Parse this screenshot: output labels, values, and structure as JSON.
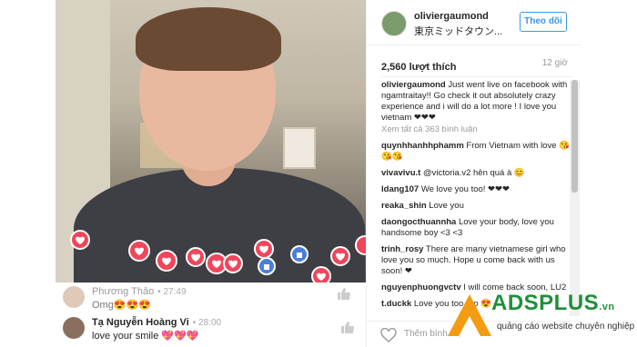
{
  "header": {
    "username": "oliviergaumond",
    "location": "東京ミッドタウン...",
    "follow_label": "Theo dõi"
  },
  "post": {
    "likes": "2,560 lượt thích",
    "time": "12 giờ"
  },
  "comments": [
    {
      "user": "oliviergaumond",
      "text": " Just went live on facebook with ngamtraitay!! Go check it out absolutely crazy experience and i will do a lot more ! I love you vietnam ❤❤❤"
    },
    {
      "user": "",
      "text": "",
      "load_more": "Xem tất cả 363 bình luận"
    },
    {
      "user": "quynhhanhhphamm",
      "text": " From Vietnam with love 😘😘😘"
    },
    {
      "user": "vivavivu.t",
      "text": " @victoria.v2 hên quá à 😊"
    },
    {
      "user": "ldang107",
      "text": " We love you too! ❤❤❤"
    },
    {
      "user": "reaka_shin",
      "text": " Love you"
    },
    {
      "user": "daongocthuannha",
      "text": " Love your body, love you handsome boy <3 <3"
    },
    {
      "user": "trinh_rosy",
      "text": " There are many vietnamese girl who love you so much. Hope u come back with us soon! ❤"
    },
    {
      "user": "nguyenphuongvctv",
      "text": " I will come back soon, LU2"
    },
    {
      "user": "t.duckk",
      "text": " Love you too bro 😍"
    }
  ],
  "add_comment_placeholder": "Thêm bình luận...",
  "live_comments": [
    {
      "name": "Phương Thảo",
      "time": "27:49",
      "text": "Omg😍😍😍"
    },
    {
      "name": "Tạ Nguyễn Hoàng Vi",
      "time": "28:00",
      "text": "love your smile 💖💖💖"
    }
  ],
  "brand": {
    "name": "ADSPLUS",
    "tld": ".vn",
    "tagline": "quảng cáo website chuyên nghiệp"
  },
  "colors": {
    "accent": "#3897f0",
    "heart": "#f0465b",
    "like_blue": "#4a7fd9",
    "brand_green": "#1f8f3a",
    "brand_orange": "#f39c12"
  }
}
